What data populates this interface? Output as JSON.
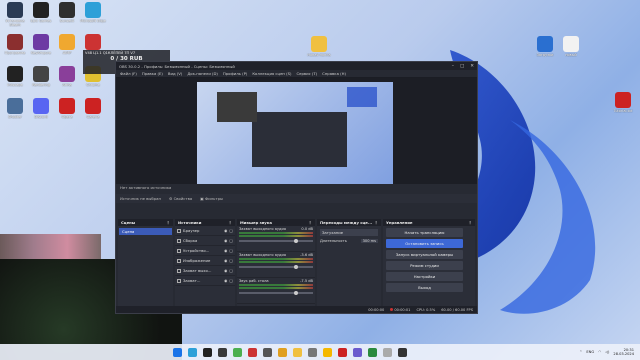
{
  "desktop": {
    "icons_left": [
      {
        "name": "steam-icon",
        "label": "Установка Steam",
        "color": "#2a3b55"
      },
      {
        "name": "epic-icon",
        "label": "Epic Games",
        "color": "#222"
      },
      {
        "name": "app3-icon",
        "label": "SunsetX",
        "color": "#2f2f2f"
      },
      {
        "name": "app4-icon",
        "label": "Microsoft Edge",
        "color": "#2da0d8"
      },
      {
        "name": "app5-icon",
        "label": "Программа",
        "color": "#8b2f2f"
      },
      {
        "name": "app6-icon",
        "label": "KeyAmpure",
        "color": "#6d3aa3"
      },
      {
        "name": "app7-icon",
        "label": "AIMP",
        "color": "#f0a830"
      },
      {
        "name": "app8-icon",
        "label": "Game Pass",
        "color": "#c33"
      },
      {
        "name": "app9-icon",
        "label": "Inkscape",
        "color": "#222"
      },
      {
        "name": "app10-icon",
        "label": "Rendering",
        "color": "#444"
      },
      {
        "name": "app11-icon",
        "label": "Arma",
        "color": "#8a3f9a"
      },
      {
        "name": "app12-icon",
        "label": "Chrome",
        "color": "#e0c030"
      },
      {
        "name": "app13-icon",
        "label": "Shooter",
        "color": "#4a6e9a"
      },
      {
        "name": "app14-icon",
        "label": "Discord",
        "color": "#5865f2"
      },
      {
        "name": "app15-icon",
        "label": "Opera",
        "color": "#c22"
      },
      {
        "name": "app16-icon",
        "label": "Garena",
        "color": "#c22"
      }
    ],
    "icons_right": [
      {
        "name": "folder-icon",
        "label": "Новая папка",
        "color": "#f0c040"
      },
      {
        "name": "download-icon",
        "label": "Загрузки",
        "color": "#2a6fd0"
      },
      {
        "name": "file-icon",
        "label": "новый",
        "color": "#f2f2f2"
      },
      {
        "name": "opera-icon",
        "label": "Tutorial.txt",
        "color": "#c22"
      }
    ]
  },
  "overlay": {
    "code": "V48 Ц1.1 Q1КЛЁПЕЙ 7П V7",
    "amount": "0 / 30 RUB"
  },
  "obs": {
    "title": "OBS 30.0.2 - Профиль: Безымянный - Сцены: Безымянный",
    "menu": [
      "Файл (F)",
      "Правка (E)",
      "Вид (V)",
      "Док-панели (D)",
      "Профиль (P)",
      "Коллекция сцен (S)",
      "Сервис (T)",
      "Справка (H)"
    ],
    "no_source": "Источник не выбран",
    "properties": "Свойства",
    "filters": "Фильтры",
    "hotkey": "Нет активного источника",
    "docks": {
      "scenes": {
        "title": "Сцены",
        "items": [
          "Сцена"
        ]
      },
      "sources": {
        "title": "Источники",
        "items": [
          "Браузер",
          "Сборка",
          "Устройство...",
          "Изображение",
          "Захват выхо...",
          "Захват..."
        ]
      },
      "mixer": {
        "title": "Микшер звука",
        "channels": [
          {
            "name": "Захват выходного аудио",
            "level": "0.0 dB"
          },
          {
            "name": "Захват выходного аудио",
            "level": "-3.6 dB"
          },
          {
            "name": "Звук раб. стола",
            "level": "-7.5 dB"
          }
        ]
      },
      "transitions": {
        "title": "Переходы между сце...",
        "type": "Затухание",
        "duration_label": "Длительность",
        "duration": "300 ms"
      },
      "controls": {
        "title": "Управление",
        "buttons": [
          {
            "label": "Начать трансляцию",
            "active": false
          },
          {
            "label": "Остановить запись",
            "active": true
          },
          {
            "label": "Запуск виртуальной камеры",
            "active": false
          },
          {
            "label": "Режим студии",
            "active": false
          },
          {
            "label": "Настройки",
            "active": false
          },
          {
            "label": "Выход",
            "active": false
          }
        ]
      }
    },
    "status": {
      "rec_time": "00:00:01",
      "stream_time": "00:00:00",
      "cpu": "CPU: 0.5%",
      "fps": "60.00 / 60.00 FPS"
    }
  },
  "taskbar": {
    "apps": [
      "#1a73e8",
      "#2da0d8",
      "#222",
      "#3a3a3a",
      "#4caf50",
      "#c33",
      "#555",
      "#e0a020",
      "#f0c040",
      "#777",
      "#f5b800",
      "#c22",
      "#6a5acd",
      "#2b8a3e",
      "#aaa",
      "#333"
    ],
    "lang": "ENG",
    "time": "20:31",
    "date": "28.03.2024"
  }
}
